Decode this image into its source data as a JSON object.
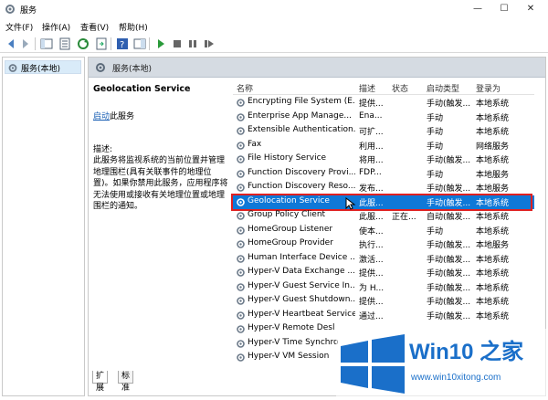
{
  "window": {
    "title": "服务",
    "minimize": "—",
    "maximize": "☐",
    "close": "✕"
  },
  "menu": [
    "文件(F)",
    "操作(A)",
    "查看(V)",
    "帮助(H)"
  ],
  "tree": {
    "root": "服务(本地)"
  },
  "panel": {
    "header": "服务(本地)",
    "service_name": "Geolocation Service",
    "start_link": "启动",
    "start_suffix": "此服务",
    "desc_label": "描述:",
    "desc_text": "此服务将监视系统的当前位置并管理地理围栏(具有关联事件的地理位置)。如果你禁用此服务，应用程序将无法使用或接收有关地理位置或地理围栏的通知。"
  },
  "tabs": [
    "扩展",
    "标准"
  ],
  "columns": [
    "名称",
    "描述",
    "状态",
    "启动类型",
    "登录为"
  ],
  "rows": [
    {
      "name": "Encrypting File System (E...",
      "desc": "提供...",
      "status": "",
      "start": "手动(触发...",
      "logon": "本地系统"
    },
    {
      "name": "Enterprise App Manage...",
      "desc": "Ena...",
      "status": "",
      "start": "手动",
      "logon": "本地系统"
    },
    {
      "name": "Extensible Authentication...",
      "desc": "可扩...",
      "status": "",
      "start": "手动",
      "logon": "本地系统"
    },
    {
      "name": "Fax",
      "desc": "利用...",
      "status": "",
      "start": "手动",
      "logon": "网络服务"
    },
    {
      "name": "File History Service",
      "desc": "将用...",
      "status": "",
      "start": "手动(触发...",
      "logon": "本地系统"
    },
    {
      "name": "Function Discovery Provi...",
      "desc": "FDP...",
      "status": "",
      "start": "手动",
      "logon": "本地服务"
    },
    {
      "name": "Function Discovery Reso...",
      "desc": "发布...",
      "status": "",
      "start": "手动(触发...",
      "logon": "本地服务"
    },
    {
      "name": "Geolocation Service",
      "desc": "此服...",
      "status": "",
      "start": "手动(触发...",
      "logon": "本地系统"
    },
    {
      "name": "Group Policy Client",
      "desc": "此服...",
      "status": "正在...",
      "start": "自动(触发...",
      "logon": "本地系统"
    },
    {
      "name": "HomeGroup Listener",
      "desc": "使本...",
      "status": "",
      "start": "手动",
      "logon": "本地系统"
    },
    {
      "name": "HomeGroup Provider",
      "desc": "执行...",
      "status": "",
      "start": "手动(触发...",
      "logon": "本地服务"
    },
    {
      "name": "Human Interface Device ...",
      "desc": "激活...",
      "status": "",
      "start": "手动(触发...",
      "logon": "本地系统"
    },
    {
      "name": "Hyper-V Data Exchange ...",
      "desc": "提供...",
      "status": "",
      "start": "手动(触发...",
      "logon": "本地系统"
    },
    {
      "name": "Hyper-V Guest Service In...",
      "desc": "为 H...",
      "status": "",
      "start": "手动(触发...",
      "logon": "本地系统"
    },
    {
      "name": "Hyper-V Guest Shutdown...",
      "desc": "提供...",
      "status": "",
      "start": "手动(触发...",
      "logon": "本地系统"
    },
    {
      "name": "Hyper-V Heartbeat Service",
      "desc": "通过...",
      "status": "",
      "start": "手动(触发...",
      "logon": "本地系统"
    },
    {
      "name": "Hyper-V Remote Desl",
      "desc": "",
      "status": "",
      "start": "",
      "logon": ""
    },
    {
      "name": "Hyper-V Time Synchro",
      "desc": "",
      "status": "",
      "start": "",
      "logon": ""
    },
    {
      "name": "Hyper-V VM Session",
      "desc": "",
      "status": "",
      "start": "",
      "logon": ""
    }
  ],
  "selected_index": 7,
  "watermark": {
    "title": "Win10 之家",
    "url": "www.win10xitong.com"
  },
  "colors": {
    "selection": "#0f78d7",
    "highlight": "#e02020",
    "brand": "#1a6fc9"
  }
}
